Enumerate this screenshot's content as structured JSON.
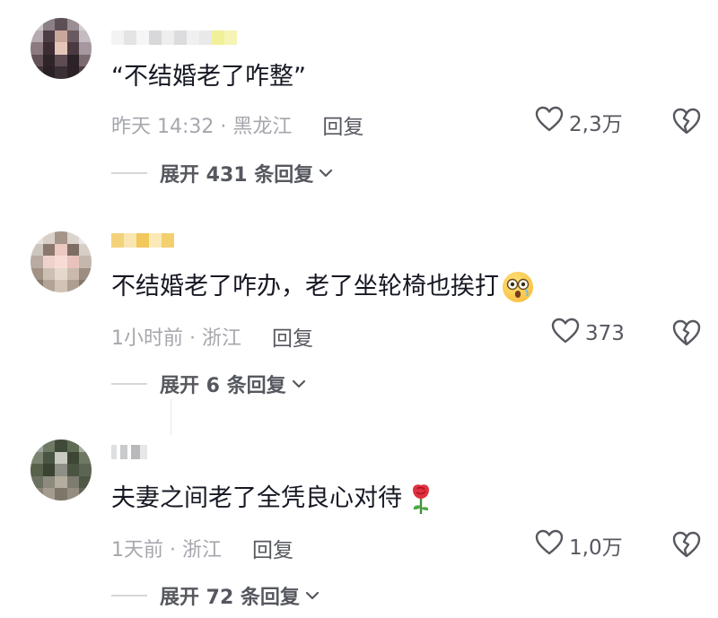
{
  "comments": [
    {
      "text": "“不结婚老了咋整”",
      "time_location": "昨天 14:32 · 黑龙江",
      "reply_label": "回复",
      "likes": "2,3万",
      "expand_label": "展开 431 条回复"
    },
    {
      "text": "不结婚老了咋办，老了坐轮椅也挨打",
      "emoji": "fearful-face-emoji",
      "time_location": "1小时前 · 浙江",
      "reply_label": "回复",
      "likes": "373",
      "expand_label": "展开 6 条回复"
    },
    {
      "text": "夫妻之间老了全凭良心对待",
      "emoji": "rose-emoji",
      "time_location": "1天前 · 浙江",
      "reply_label": "回复",
      "likes": "1,0万",
      "expand_label": "展开 72 条回复"
    }
  ],
  "colors": {
    "text_primary": "#161823",
    "text_meta": "#a5a7ad",
    "text_action": "#56585f",
    "divider": "#d6d7da"
  },
  "icons": {
    "like": "heart-outline-icon",
    "dislike": "broken-heart-icon",
    "expand": "chevron-down-icon"
  }
}
